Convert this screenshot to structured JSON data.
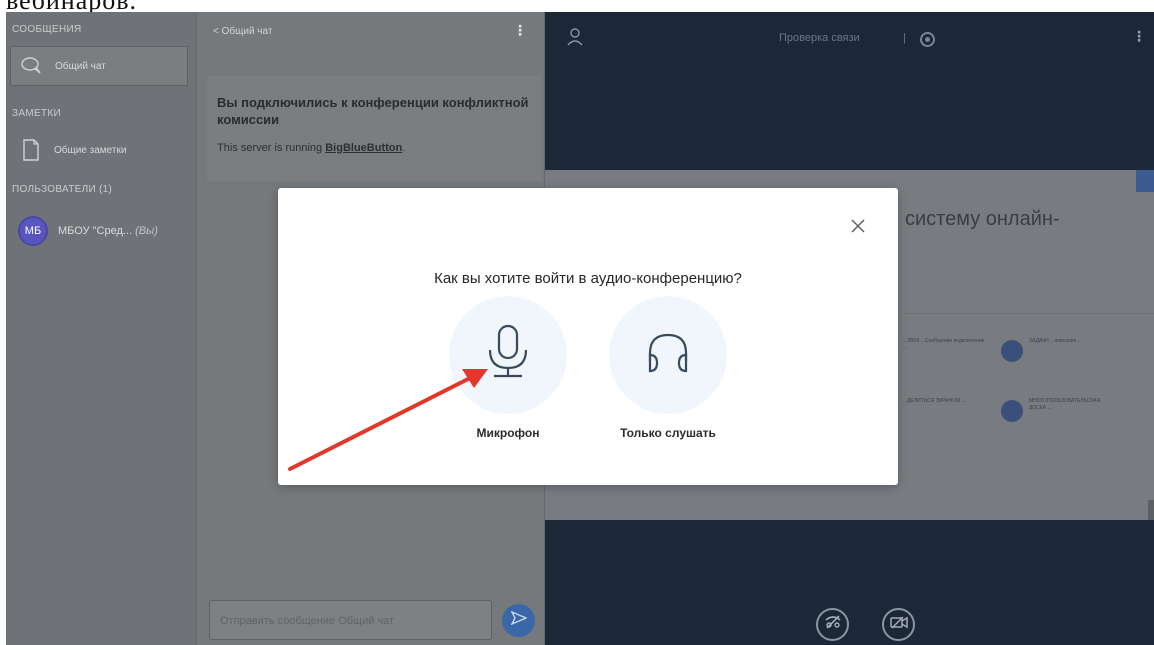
{
  "page": {
    "top_text": "вебинаров."
  },
  "sidebar": {
    "messages_title": "СООБЩЕНИЯ",
    "public_chat_label": "Общий чат",
    "notes_title": "ЗАМЕТКИ",
    "shared_notes_label": "Общие заметки",
    "users_title": "ПОЛЬЗОВАТЕЛИ (1)",
    "user": {
      "initials": "МБ",
      "name": "МБОУ \"Сред...",
      "you_suffix": "(Вы)"
    }
  },
  "chat": {
    "back_label": "Общий чат",
    "welcome_line1": "Вы подключились к конференции конфликтной комиссии",
    "welcome_line2_prefix": "This server is running ",
    "welcome_link": "BigBlueButton",
    "welcome_line2_suffix": ".",
    "input_placeholder": "Отправить сообщение Общий чат"
  },
  "stage": {
    "title": "Проверка связи",
    "separator": "|",
    "slide_heading": "систему онлайн-",
    "slide_captions": [
      "...ЗВУК ...Сообщение подключение ...",
      "ЗАДАЧИ ...описание ...",
      "...ДЕЛИТЬСЯ ЭКРАНОМ ...",
      "МНОГОПОЛЬЗОВАТЕЛЬСКАЯ ДОСКА ..."
    ]
  },
  "modal": {
    "title": "Как вы хотите войти в аудио-конференцию?",
    "option_microphone": "Микрофон",
    "option_listen_only": "Только слушать"
  },
  "colors": {
    "accent_blue": "#3a67a8",
    "annotation_arrow": "#e2372b",
    "avatar": "#5a56c0"
  }
}
